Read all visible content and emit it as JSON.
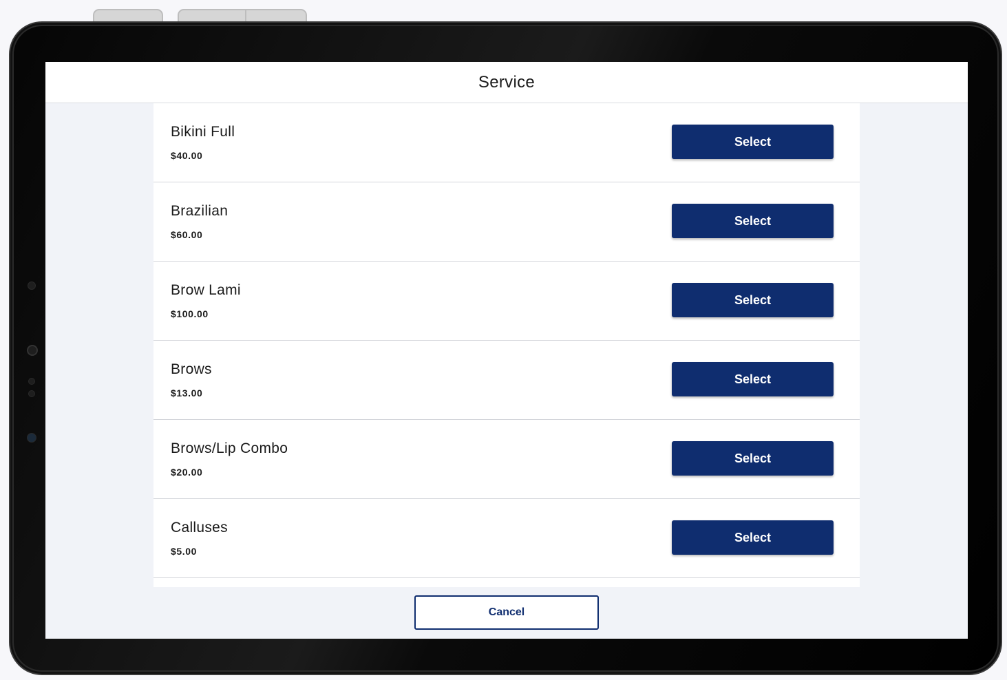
{
  "header": {
    "title": "Service"
  },
  "services": [
    {
      "name": "Bikini Full",
      "price": "$40.00",
      "button_label": "Select"
    },
    {
      "name": "Brazilian",
      "price": "$60.00",
      "button_label": "Select"
    },
    {
      "name": "Brow Lami",
      "price": "$100.00",
      "button_label": "Select"
    },
    {
      "name": "Brows",
      "price": "$13.00",
      "button_label": "Select"
    },
    {
      "name": "Brows/Lip Combo",
      "price": "$20.00",
      "button_label": "Select"
    },
    {
      "name": "Calluses",
      "price": "$5.00",
      "button_label": "Select"
    }
  ],
  "footer": {
    "cancel_label": "Cancel"
  },
  "colors": {
    "accent": "#0f2d6f",
    "background": "#f1f3f8",
    "panel": "#ffffff"
  }
}
